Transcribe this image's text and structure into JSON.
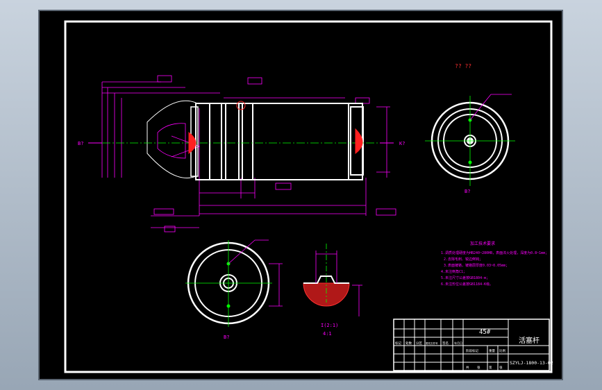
{
  "title_block": {
    "material": "45#",
    "part_name": "活塞杆",
    "drawing_no": "SZYLJ-1800-13-02",
    "sign_row_labels": [
      "标记",
      "处数",
      "分区",
      "更改文件号",
      "签名",
      "年月日"
    ],
    "stage_labels": [
      "阶段标记",
      "重量",
      "比例"
    ],
    "bottom_labels": [
      "共",
      "张",
      "第",
      "张"
    ]
  },
  "tech_requirements": {
    "heading": "加工技术要求",
    "items": [
      "1.调质处理硬度为HB240~280HB，表面淬火处理，深度为0.8~1mm；",
      "2.去除毛刺、锐边倒钝；",
      "3.表面镀铬，镀铬层厚度0.03~0.05mm；",
      "4.未注倒角C1；",
      "5.未注尺寸公差按GB1804-m；",
      "6.未注形位公差按GB1184-K级。"
    ]
  },
  "views": {
    "top_label": "?? ??",
    "left_arrow_label": "B?",
    "right_arrow_label": "K?",
    "right_view_label": "B?",
    "bottom_left_label": "B?",
    "detail_label_top": "I(2:1)",
    "detail_label_bottom": "4:1"
  },
  "colors": {
    "dimension": "#ff00ff",
    "outline": "#ffffff",
    "centerline": "#00ff00",
    "hatch": "#ff2020"
  }
}
